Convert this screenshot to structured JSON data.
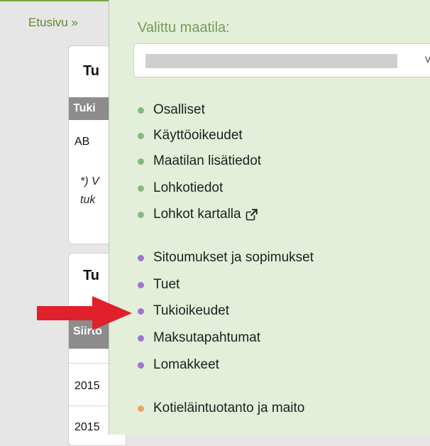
{
  "breadcrumb": {
    "home_label": "Etusivu »"
  },
  "background": {
    "card1": {
      "title_fragment": "Tu",
      "header_fragment": "Tuki",
      "cell": "AB",
      "note_line1": "*) V",
      "note_line2": "tuk"
    },
    "card2": {
      "title_fragment": "Tu",
      "header_fragment": "Siirto",
      "row1": "2015",
      "row2": "2015"
    }
  },
  "dropdown": {
    "label": "Valittu maatila:",
    "select_value": "",
    "select_chevron": "v",
    "groups": [
      {
        "color": "#83ba83",
        "items": [
          "Osalliset",
          "Käyttöoikeudet",
          "Maatilan lisätiedot",
          "Lohkotiedot",
          "Lohkot kartalla"
        ]
      },
      {
        "color": "#a472d4",
        "items": [
          "Sitoumukset ja sopimukset",
          "Tuet",
          "Tukioikeudet",
          "Maksutapahtumat",
          "Lomakkeet"
        ]
      },
      {
        "color": "#eba46a",
        "items": [
          "Kotieläintuotanto ja maito"
        ]
      }
    ]
  },
  "annotation": {
    "arrow_color": "#e0202a",
    "arrow_target": "Tukioikeudet"
  },
  "icons": {
    "external_link": "external-link-icon"
  }
}
